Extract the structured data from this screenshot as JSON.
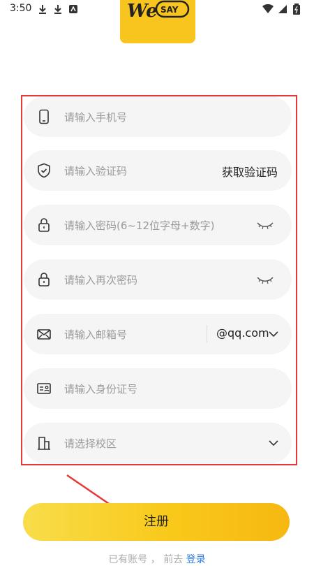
{
  "status_bar": {
    "time": "3:50"
  },
  "logo": {
    "text_we": "We",
    "text_say": "SAY"
  },
  "form": {
    "phone_placeholder": "请输入手机号",
    "code_placeholder": "请输入验证码",
    "get_code_label": "获取验证码",
    "password_placeholder": "请输入密码(6~12位字母+数字)",
    "password_confirm_placeholder": "请输入再次密码",
    "email_placeholder": "请输入邮箱号",
    "email_domain": "@qq.com",
    "id_placeholder": "请输入身份证号",
    "campus_placeholder": "请选择校区"
  },
  "actions": {
    "register_label": "注册"
  },
  "footer": {
    "prefix": "已有账号",
    "middle": "前去",
    "login_label": "登录"
  },
  "colors": {
    "accent": "#f9c91a",
    "highlight": "#e53935",
    "link": "#2f7fe6"
  }
}
